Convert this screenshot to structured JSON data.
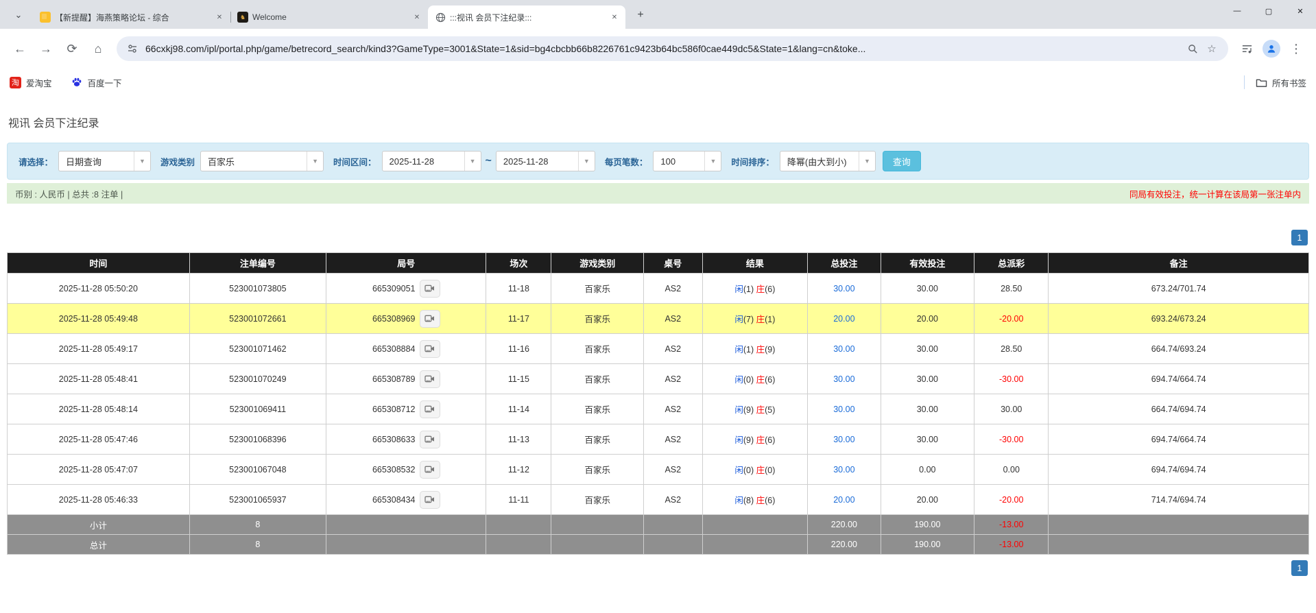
{
  "browser": {
    "tabs": [
      {
        "title": "【新提醒】海燕策略论坛 - 综合",
        "close": "✕"
      },
      {
        "title": "Welcome",
        "close": "✕"
      },
      {
        "title": ":::视讯 会员下注纪录:::",
        "close": "✕"
      }
    ],
    "new_tab": "+",
    "window": {
      "minimize": "—",
      "maximize": "▢",
      "close": "✕"
    },
    "url": "66cxkj98.com/ipl/portal.php/game/betrecord_search/kind3?GameType=3001&State=1&sid=bg4cbcbb66b8226761c9423b64bc586f0cae449dc5&State=1&lang=cn&toke...",
    "nav": {
      "back": "←",
      "forward": "→",
      "reload": "⟳",
      "home": "⌂",
      "bookmark_star": "☆",
      "menu": "⋮"
    },
    "bookmarks": {
      "items": [
        {
          "label": "爱淘宝"
        },
        {
          "label": "百度一下"
        }
      ],
      "all_bookmarks": "所有书签"
    }
  },
  "page": {
    "title": "视讯 会员下注纪录",
    "filters": {
      "select_label": "请选择：",
      "select_value": "日期查询",
      "game_type_label": "游戏类别",
      "game_type_value": "百家乐",
      "date_range_label": "时间区间：",
      "date_from": "2025-11-28",
      "range_separator": "~",
      "date_to": "2025-11-28",
      "page_size_label": "每页笔数：",
      "page_size_value": "100",
      "sort_label": "时间排序：",
      "sort_value": "降幂(由大到小)",
      "query_button": "查询"
    },
    "info_bar": {
      "left": "币别 : 人民币 | 总共 :8 注单 |",
      "right": "同局有效投注，统一计算在该局第一张注单内"
    },
    "pagination": {
      "page": "1"
    },
    "colors": {
      "accent_blue": "#337ab7",
      "link_blue": "#1a6bd8",
      "player_blue": "#1a5adb",
      "banker_red": "#ff0000",
      "negative_red": "#ff0000",
      "highlight_yellow": "#ffff99",
      "header_dark": "#1d1d1d",
      "footer_gray": "#8f8f8f",
      "filter_bg": "#d9edf7",
      "info_bg": "#dff0d8",
      "query_btn": "#5bc0de"
    },
    "table": {
      "headers": [
        "时间",
        "注单编号",
        "局号",
        "场次",
        "游戏类别",
        "桌号",
        "结果",
        "总投注",
        "有效投注",
        "总派彩",
        "备注"
      ],
      "rows": [
        {
          "time": "2025-11-28 05:50:20",
          "bet_id": "523001073805",
          "round_id": "665309051",
          "session": "11-18",
          "game": "百家乐",
          "table_no": "AS2",
          "res_p": "闲",
          "res_p_n": "(1)",
          "res_b": "庄",
          "res_b_n": "(6)",
          "total_bet": "30.00",
          "valid_bet": "30.00",
          "payout": "28.50",
          "remark": "673.24/701.74",
          "highlight": false
        },
        {
          "time": "2025-11-28 05:49:48",
          "bet_id": "523001072661",
          "round_id": "665308969",
          "session": "11-17",
          "game": "百家乐",
          "table_no": "AS2",
          "res_p": "闲",
          "res_p_n": "(7)",
          "res_b": "庄",
          "res_b_n": "(1)",
          "total_bet": "20.00",
          "valid_bet": "20.00",
          "payout": "-20.00",
          "remark": "693.24/673.24",
          "highlight": true
        },
        {
          "time": "2025-11-28 05:49:17",
          "bet_id": "523001071462",
          "round_id": "665308884",
          "session": "11-16",
          "game": "百家乐",
          "table_no": "AS2",
          "res_p": "闲",
          "res_p_n": "(1)",
          "res_b": "庄",
          "res_b_n": "(9)",
          "total_bet": "30.00",
          "valid_bet": "30.00",
          "payout": "28.50",
          "remark": "664.74/693.24",
          "highlight": false
        },
        {
          "time": "2025-11-28 05:48:41",
          "bet_id": "523001070249",
          "round_id": "665308789",
          "session": "11-15",
          "game": "百家乐",
          "table_no": "AS2",
          "res_p": "闲",
          "res_p_n": "(0)",
          "res_b": "庄",
          "res_b_n": "(6)",
          "total_bet": "30.00",
          "valid_bet": "30.00",
          "payout": "-30.00",
          "remark": "694.74/664.74",
          "highlight": false
        },
        {
          "time": "2025-11-28 05:48:14",
          "bet_id": "523001069411",
          "round_id": "665308712",
          "session": "11-14",
          "game": "百家乐",
          "table_no": "AS2",
          "res_p": "闲",
          "res_p_n": "(9)",
          "res_b": "庄",
          "res_b_n": "(5)",
          "total_bet": "30.00",
          "valid_bet": "30.00",
          "payout": "30.00",
          "remark": "664.74/694.74",
          "highlight": false
        },
        {
          "time": "2025-11-28 05:47:46",
          "bet_id": "523001068396",
          "round_id": "665308633",
          "session": "11-13",
          "game": "百家乐",
          "table_no": "AS2",
          "res_p": "闲",
          "res_p_n": "(9)",
          "res_b": "庄",
          "res_b_n": "(6)",
          "total_bet": "30.00",
          "valid_bet": "30.00",
          "payout": "-30.00",
          "remark": "694.74/664.74",
          "highlight": false
        },
        {
          "time": "2025-11-28 05:47:07",
          "bet_id": "523001067048",
          "round_id": "665308532",
          "session": "11-12",
          "game": "百家乐",
          "table_no": "AS2",
          "res_p": "闲",
          "res_p_n": "(0)",
          "res_b": "庄",
          "res_b_n": "(0)",
          "total_bet": "30.00",
          "valid_bet": "0.00",
          "payout": "0.00",
          "remark": "694.74/694.74",
          "highlight": false
        },
        {
          "time": "2025-11-28 05:46:33",
          "bet_id": "523001065937",
          "round_id": "665308434",
          "session": "11-11",
          "game": "百家乐",
          "table_no": "AS2",
          "res_p": "闲",
          "res_p_n": "(8)",
          "res_b": "庄",
          "res_b_n": "(6)",
          "total_bet": "20.00",
          "valid_bet": "20.00",
          "payout": "-20.00",
          "remark": "714.74/694.74",
          "highlight": false
        }
      ],
      "subtotal": {
        "label": "小计",
        "count": "8",
        "total_bet": "220.00",
        "valid_bet": "190.00",
        "payout": "-13.00"
      },
      "total": {
        "label": "总计",
        "count": "8",
        "total_bet": "220.00",
        "valid_bet": "190.00",
        "payout": "-13.00"
      }
    }
  }
}
